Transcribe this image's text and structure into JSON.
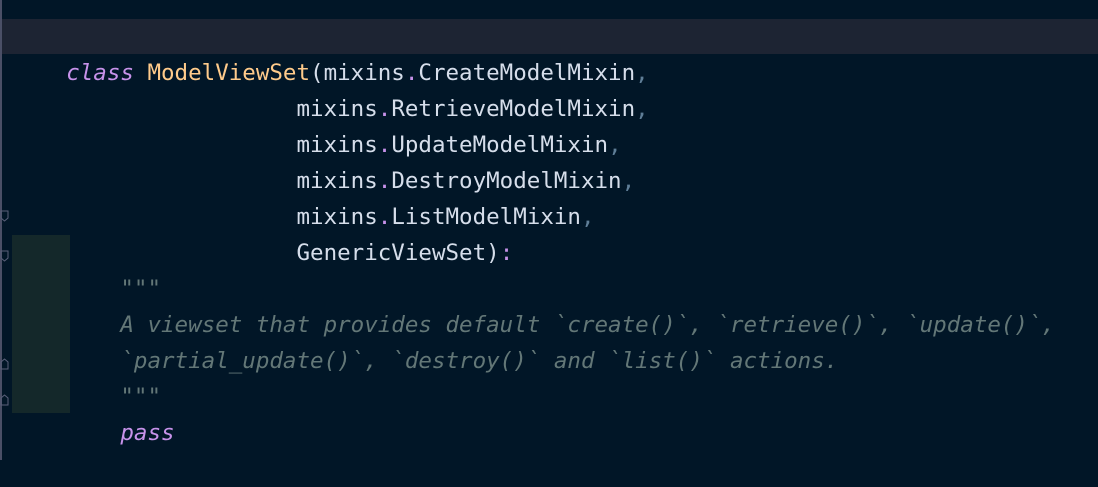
{
  "code": {
    "line1": {
      "keyword": "class",
      "class_name": "ModelViewSet",
      "open_paren": "(",
      "module": "mixins",
      "dot": ".",
      "attr": "CreateModelMixin",
      "comma": ","
    },
    "line2": {
      "module": "mixins",
      "dot": ".",
      "attr": "RetrieveModelMixin",
      "comma": ","
    },
    "line3": {
      "module": "mixins",
      "dot": ".",
      "attr": "UpdateModelMixin",
      "comma": ","
    },
    "line4": {
      "module": "mixins",
      "dot": ".",
      "attr": "DestroyModelMixin",
      "comma": ","
    },
    "line5": {
      "module": "mixins",
      "dot": ".",
      "attr": "ListModelMixin",
      "comma": ","
    },
    "line6": {
      "base": "GenericViewSet",
      "close_paren": ")",
      "colon": ":"
    },
    "docstring": {
      "open": "\"\"\"",
      "line1": "A viewset that provides default `create()`, `retrieve()`, `update()`,",
      "line2": "`partial_update()`, `destroy()` and `list()` actions.",
      "close": "\"\"\""
    },
    "pass_keyword": "pass"
  },
  "colors": {
    "background": "#011627",
    "keyword": "#c792ea",
    "class_name": "#ffcb8b",
    "identifier": "#d6deeb",
    "comma": "#5f7e97",
    "docstring": "#637777",
    "current_line": "#1d2433"
  }
}
